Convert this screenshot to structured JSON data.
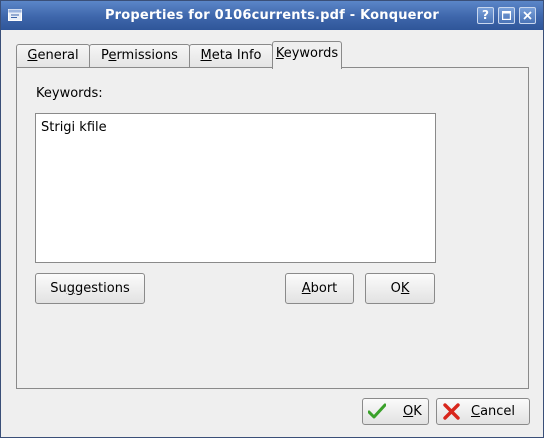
{
  "window": {
    "title": "Properties for 0106currents.pdf - Konqueror",
    "buttons": {
      "help": "?",
      "maximize": "maximize-icon",
      "close": "close-icon"
    }
  },
  "tabs": [
    {
      "pre": "",
      "key": "G",
      "post": "eneral"
    },
    {
      "pre": "P",
      "key": "e",
      "post": "rmissions"
    },
    {
      "pre": "",
      "key": "M",
      "post": "eta Info"
    },
    {
      "pre": "",
      "key": "K",
      "post": "eywords"
    }
  ],
  "active_tab": "Keywords",
  "keywords": {
    "label": "Keywords:",
    "value": "Strigi kfile"
  },
  "buttons": {
    "suggestions": {
      "pre": "Su",
      "key": "g",
      "post": "gestions"
    },
    "abort": {
      "pre": "",
      "key": "A",
      "post": "bort"
    },
    "ok_inner": {
      "pre": "O",
      "key": "K",
      "post": ""
    },
    "ok": {
      "pre": "",
      "key": "O",
      "post": "K"
    },
    "cancel": {
      "pre": "",
      "key": "C",
      "post": "ancel"
    }
  },
  "colors": {
    "titlebar": "#3e66ab",
    "ok_icon": "#3aa12a",
    "cancel_icon": "#d8261c"
  }
}
